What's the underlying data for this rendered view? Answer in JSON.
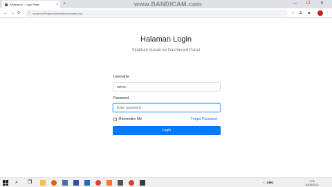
{
  "browser": {
    "tab_title": "IVMansion - Login Page",
    "tab_close": "×",
    "new_tab": "+",
    "watermark": "www.BANDICAM.com",
    "url": "localhost/Project/Aesthetic/Ion/index.php",
    "lock": "ⓘ",
    "back": "←",
    "forward": "→",
    "reload": "⟳",
    "window_controls": [
      "—",
      "☐",
      "✕"
    ],
    "toolbar_icons": [
      "☆",
      "⧉",
      "◆"
    ],
    "menu": "⋮"
  },
  "login": {
    "title": "Halaman Login",
    "subtitle": "Silahkan masuk ke Dashboard Panel",
    "username_label": "Username",
    "username_value": "admin",
    "password_label": "Password",
    "password_placeholder": "Enter password",
    "remember_label": "Remember Me",
    "forgot_label": "Forgot Password",
    "login_button": "Login"
  },
  "taskbar": {
    "search_icon": "⌕",
    "task_view_icon": "❐",
    "apps": [
      "explorer-icon",
      "firefox-icon",
      "notepad-icon",
      "word-icon",
      "vscode-icon",
      "chrome-icon",
      "xampp-icon",
      "bandicam-icon",
      "media-icon",
      "app-icon"
    ],
    "tray": "^ ♪ 𝗘𝗡𝗚",
    "time": "7:06",
    "date": "10/05/2021"
  },
  "colors": {
    "primary": "#007bff",
    "tabbar": "#dee1e6",
    "taskbar": "#f0f0f0"
  }
}
